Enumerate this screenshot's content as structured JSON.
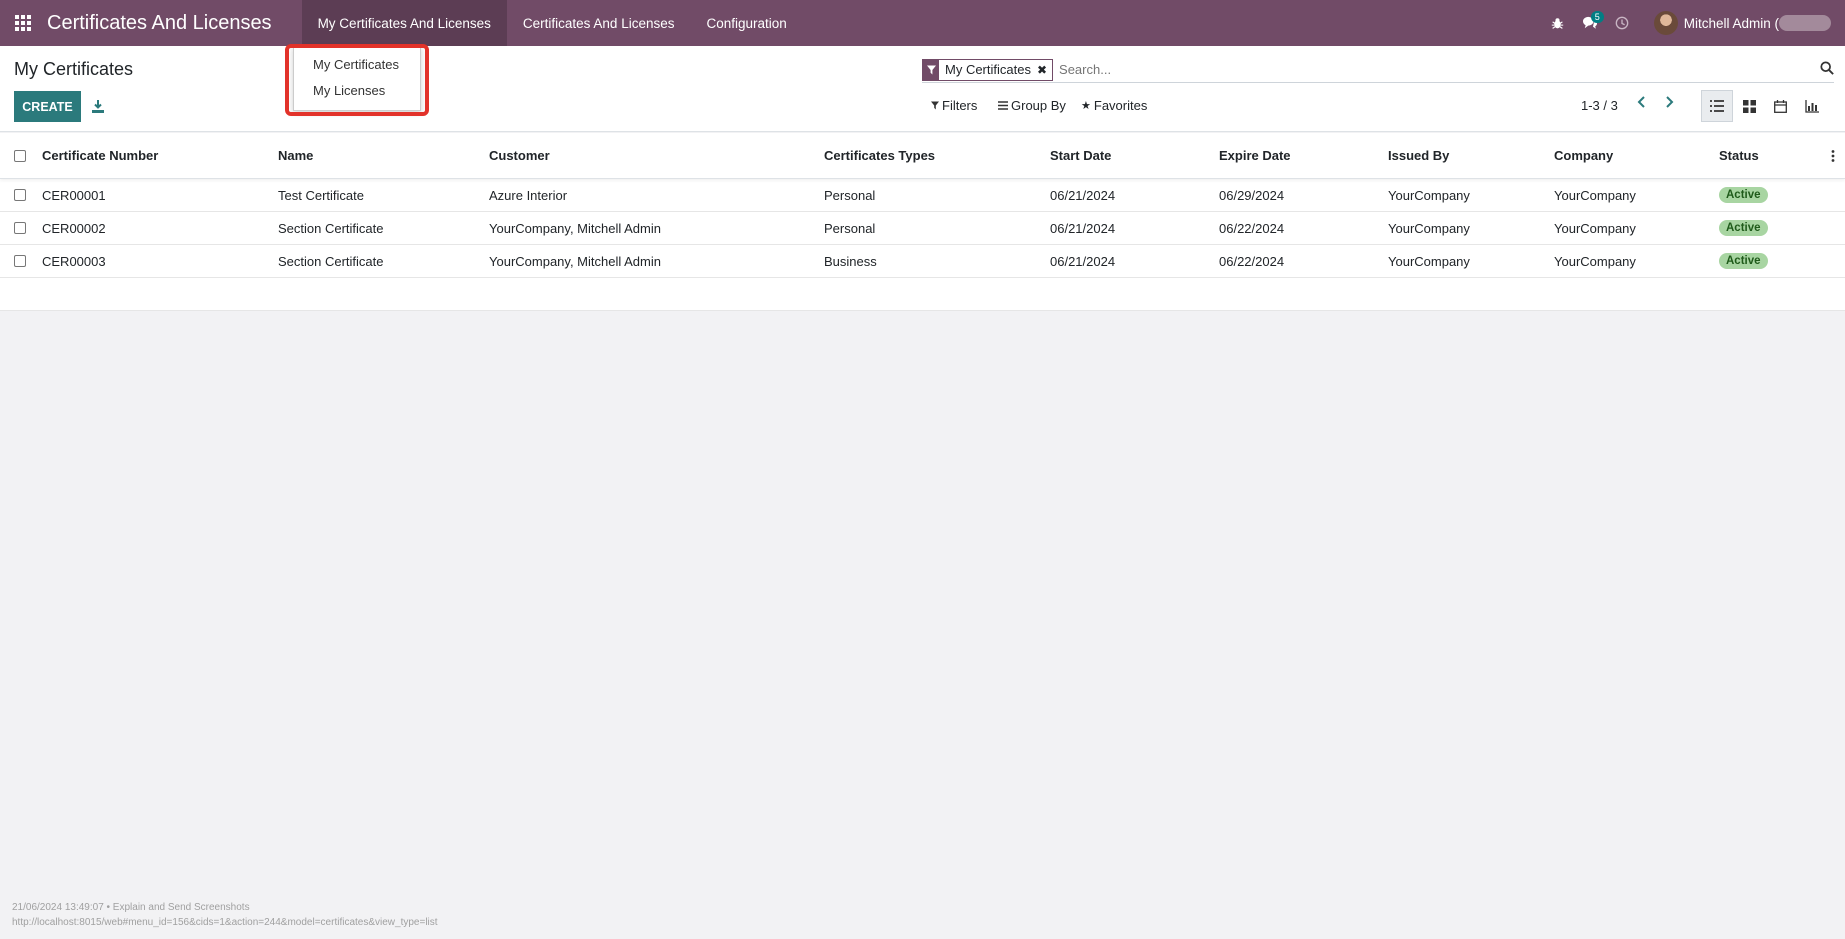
{
  "navbar": {
    "brand": "Certificates And Licenses",
    "menus": [
      "My Certificates And Licenses",
      "Certificates And Licenses",
      "Configuration"
    ],
    "message_count": "5",
    "user_name": "Mitchell Admin ("
  },
  "dropdown": {
    "items": [
      "My Certificates",
      "My Licenses"
    ]
  },
  "control": {
    "title": "My Certificates",
    "create_label": "CREATE",
    "facet_label": "My Certificates",
    "search_placeholder": "Search...",
    "filters_label": "Filters",
    "groupby_label": "Group By",
    "favorites_label": "Favorites",
    "pager": "1-3 / 3"
  },
  "table": {
    "columns": [
      "Certificate Number",
      "Name",
      "Customer",
      "Certificates Types",
      "Start Date",
      "Expire Date",
      "Issued By",
      "Company",
      "Status"
    ],
    "rows": [
      [
        "CER00001",
        "Test Certificate",
        "Azure Interior",
        "Personal",
        "06/21/2024",
        "06/29/2024",
        "YourCompany",
        "YourCompany",
        "Active"
      ],
      [
        "CER00002",
        "Section Certificate",
        "YourCompany, Mitchell Admin",
        "Personal",
        "06/21/2024",
        "06/22/2024",
        "YourCompany",
        "YourCompany",
        "Active"
      ],
      [
        "CER00003",
        "Section Certificate",
        "YourCompany, Mitchell Admin",
        "Business",
        "06/21/2024",
        "06/22/2024",
        "YourCompany",
        "YourCompany",
        "Active"
      ]
    ]
  },
  "footer": {
    "line1": "21/06/2024 13:49:07 • Explain and Send Screenshots",
    "line2": "http://localhost:8015/web#menu_id=156&cids=1&action=244&model=certificates&view_type=list"
  },
  "colors": {
    "navbar": "#714b67",
    "primary_button": "#2b7a7c",
    "highlight": "#e2322a",
    "status_active": "#a8d5a2"
  }
}
